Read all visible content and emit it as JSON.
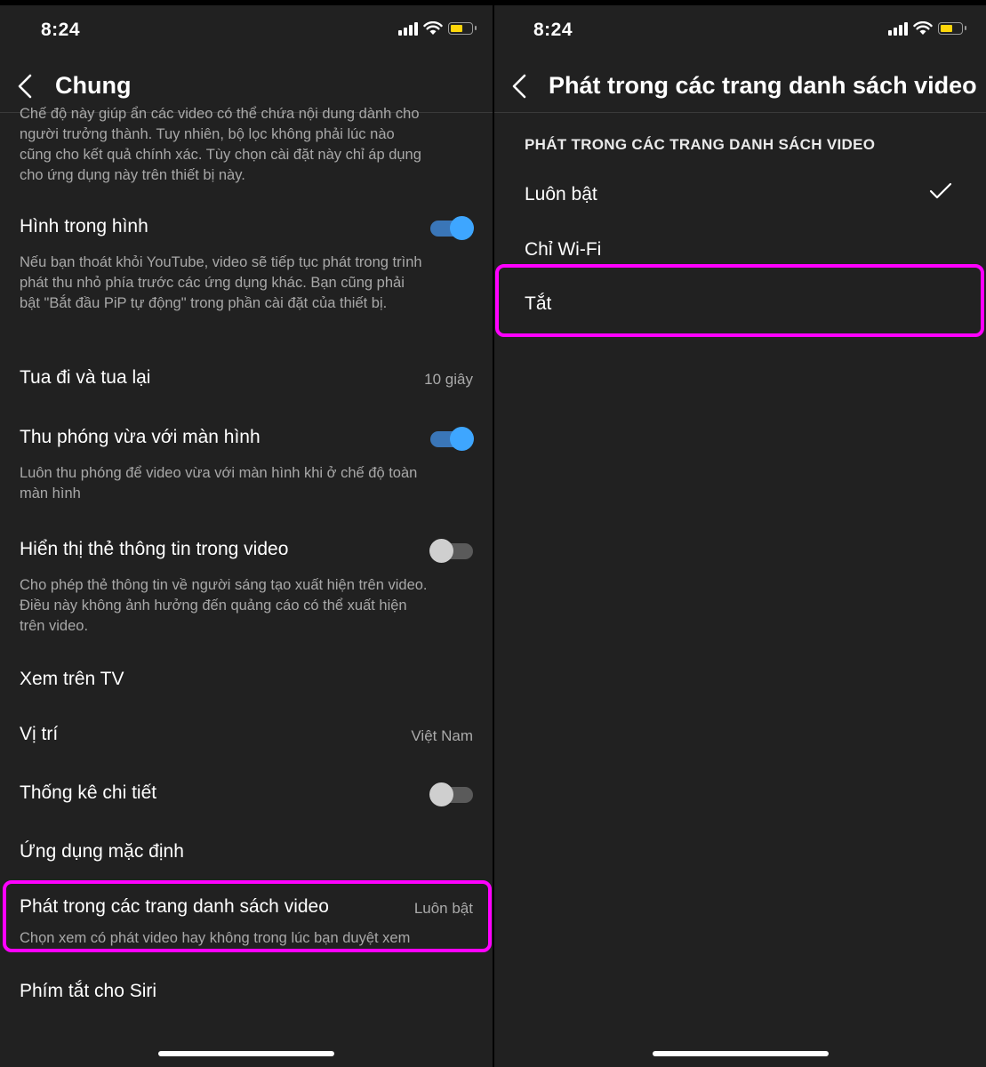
{
  "left": {
    "status": {
      "time": "8:24"
    },
    "nav": {
      "title": "Chung"
    },
    "intro_text": "Chế độ này giúp ẩn các video có thể chứa nội dung dành cho người trưởng thành. Tuy nhiên, bộ lọc không phải lúc nào cũng cho kết quả chính xác. Tùy chọn cài đặt này chỉ áp dụng cho ứng dụng này trên thiết bị này.",
    "settings": {
      "pip": {
        "label": "Hình trong hình",
        "toggle_on": true,
        "desc": "Nếu bạn thoát khỏi YouTube, video sẽ tiếp tục phát trong trình phát thu nhỏ phía trước các ứng dụng khác. Bạn cũng phải bật \"Bắt đầu PiP tự động\" trong phần cài đặt của thiết bị."
      },
      "seek": {
        "label": "Tua đi và tua lại",
        "value": "10 giây"
      },
      "zoom": {
        "label": "Thu phóng vừa với màn hình",
        "toggle_on": true,
        "desc": "Luôn thu phóng để video vừa với màn hình khi ở chế độ toàn màn hình"
      },
      "info_cards": {
        "label": "Hiển thị thẻ thông tin trong video",
        "toggle_on": false,
        "desc": "Cho phép thẻ thông tin về người sáng tạo xuất hiện trên video. Điều này không ảnh hưởng đến quảng cáo có thể xuất hiện trên video."
      },
      "watch_tv": {
        "label": "Xem trên TV"
      },
      "location": {
        "label": "Vị trí",
        "value": "Việt Nam"
      },
      "stats": {
        "label": "Thống kê chi tiết",
        "toggle_on": false
      },
      "default_apps": {
        "label": "Ứng dụng mặc định"
      },
      "playback_feeds": {
        "label": "Phát trong các trang danh sách video",
        "value": "Luôn bật",
        "desc": "Chọn xem có phát video hay không trong lúc bạn duyệt xem"
      },
      "siri": {
        "label": "Phím tắt cho Siri"
      }
    }
  },
  "right": {
    "status": {
      "time": "8:24"
    },
    "nav": {
      "title": "Phát trong các trang danh sách video"
    },
    "section_header": "PHÁT TRONG CÁC TRANG DANH SÁCH VIDEO",
    "options": [
      {
        "label": "Luôn bật",
        "selected": true
      },
      {
        "label": "Chỉ Wi-Fi",
        "selected": false
      },
      {
        "label": "Tắt",
        "selected": false
      }
    ]
  },
  "colors": {
    "background": "#212121",
    "highlight": "#ff00ff",
    "toggle_on": "#3ea6ff",
    "battery": "#ffd60a"
  },
  "icons": [
    "signal-icon",
    "wifi-icon",
    "battery-icon",
    "back-chevron-icon",
    "checkmark-icon"
  ]
}
